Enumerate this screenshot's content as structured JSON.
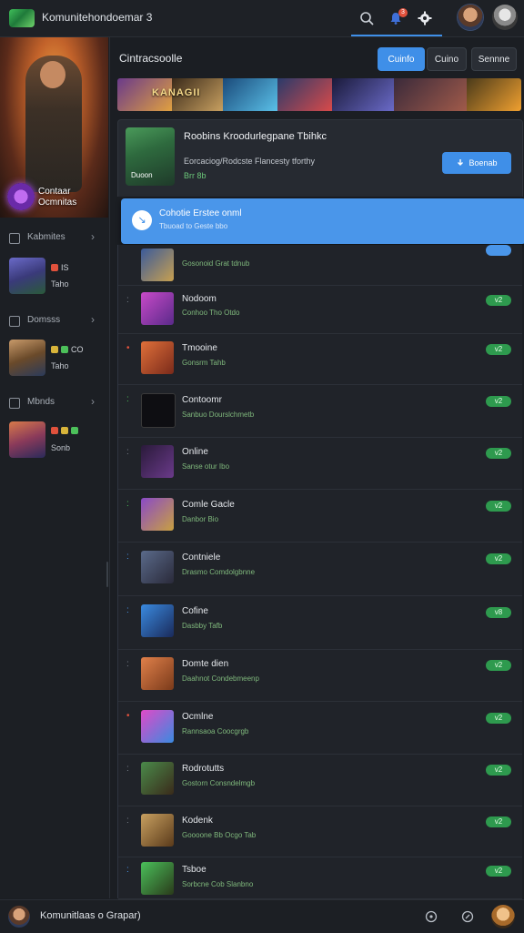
{
  "app": {
    "title": "Komunitehondoemar 3",
    "notification_count": "3"
  },
  "topbar": {
    "icons": [
      "search-icon",
      "notification-icon",
      "settings-icon"
    ]
  },
  "sidebar": {
    "hero_title": "Contaar Ocmnitas",
    "sections": [
      {
        "label": "Kabmites"
      },
      {
        "label": "Domsss"
      },
      {
        "label": "Mbnds"
      }
    ],
    "items": [
      {
        "mini": "IS",
        "tag": "Taho"
      },
      {
        "mini": "CO",
        "tag": "Taho"
      },
      {
        "mini": "",
        "tag": "Sonb"
      }
    ]
  },
  "main": {
    "title": "Cintracsoolle",
    "tabs": [
      {
        "label": "Cuinfo",
        "active": true
      },
      {
        "label": "Cuino",
        "active": false
      },
      {
        "label": "Sennne",
        "active": false
      }
    ],
    "banner_text": "KANAGII",
    "feature": {
      "title": "Roobins Kroodurlegpane Tbihkc",
      "desc": "Eorcaciog/Rodcste Flancesty tforthy",
      "stat": "Brr 8b",
      "thumb_label": "Duoon",
      "button": "Boenab"
    },
    "notice": {
      "title": "Cohotie Erstee onml",
      "sub": "Tbuoad to Geste bbo"
    },
    "rows": [
      {
        "name": "",
        "sub": "Gosonoid Grat tdnub",
        "badge": ""
      },
      {
        "name": "Nodoom",
        "sub": "Conhoo Tho Otdo",
        "badge": "v2"
      },
      {
        "name": "Tmooine",
        "sub": "Gonsrm Tahb",
        "badge": "v2"
      },
      {
        "name": "Contoomr",
        "sub": "Sanbuo Dourslchmetb",
        "badge": "v2"
      },
      {
        "name": "Online",
        "sub": "Sanse otur Ibo",
        "badge": "v2"
      },
      {
        "name": "Comle Gacle",
        "sub": "Danbor Bio",
        "badge": "v2"
      },
      {
        "name": "Contniele",
        "sub": "Drasmo Comdolgbnne",
        "badge": "v2"
      },
      {
        "name": "Cofine",
        "sub": "Dasbby Tafb",
        "badge": "v8"
      },
      {
        "name": "Domte dien",
        "sub": "Daahnot Condebmeenp",
        "badge": "v2"
      },
      {
        "name": "Ocmlne",
        "sub": "Rannsaoa Coocgrgb",
        "badge": "v2"
      },
      {
        "name": "Rodrotutts",
        "sub": "Gostorn Consndelmgb",
        "badge": "v2"
      },
      {
        "name": "Kodenk",
        "sub": "Goooone Bb Ocgo Tab",
        "badge": "v2"
      },
      {
        "name": "Tsboe",
        "sub": "Sorbcne Cob Slanbno",
        "badge": "v2"
      }
    ]
  },
  "bottombar": {
    "user": "Komunitlaas o Grapar)"
  }
}
